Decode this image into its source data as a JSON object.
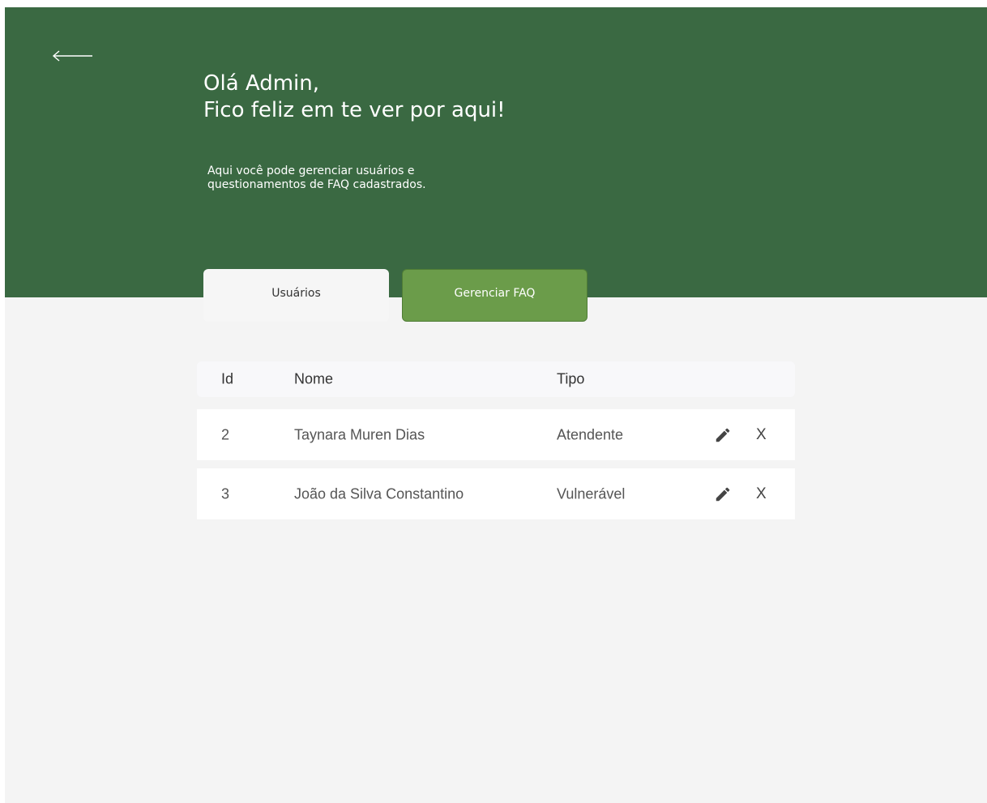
{
  "header": {
    "greeting_line1": "Olá Admin,",
    "greeting_line2": "Fico feliz em te ver por aqui!",
    "description": "Aqui você pode gerenciar usuários e questionamentos de FAQ cadastrados.",
    "back_icon": "arrow-left-icon"
  },
  "tabs": [
    {
      "label": "Usuários",
      "active": true
    },
    {
      "label": "Gerenciar FAQ",
      "active": false
    }
  ],
  "table": {
    "columns": {
      "id": "Id",
      "nome": "Nome",
      "tipo": "Tipo"
    },
    "rows": [
      {
        "id": "2",
        "nome": "Taynara Muren Dias",
        "tipo": "Atendente",
        "delete_label": "X"
      },
      {
        "id": "3",
        "nome": "João da Silva Constantino",
        "tipo": "Vulnerável",
        "delete_label": "X"
      }
    ]
  },
  "colors": {
    "header_green": "#3a6942",
    "button_green": "#6b9c4a",
    "background": "#f4f4f4"
  }
}
